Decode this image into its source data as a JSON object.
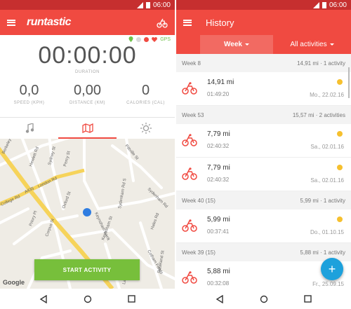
{
  "status_time": "06:00",
  "tracker": {
    "logo": "runtastic",
    "gps_label": "GPS",
    "duration_value": "00:00:00",
    "duration_label": "DURATION",
    "stats": [
      {
        "value": "0,0",
        "label": "SPEED (KPH)"
      },
      {
        "value": "0,00",
        "label": "DISTANCE (KM)"
      },
      {
        "value": "0",
        "label": "CALORIES (CAL)"
      }
    ],
    "tabs": [
      "music-icon",
      "map-icon",
      "weather-icon"
    ],
    "active_tab": 1,
    "map": {
      "streets": [
        "Berkeley St",
        "Hewlett Rd",
        "Sydney St",
        "Percy St",
        "Pittville St",
        "College Rd",
        "A435",
        "London Rd",
        "Oxford St",
        "Priory Pl",
        "Sydenham Rd",
        "Keynsham Bank",
        "Keynsham St",
        "Sydenham Rd S",
        "Hales Rd",
        "Cotham Fields",
        "Roseland St",
        "Corpus St",
        "Laxton Rd"
      ],
      "attribution": "Google"
    },
    "start_button": "START ACTIVITY"
  },
  "history": {
    "title": "History",
    "filter_week": "Week",
    "filter_all": "All activities",
    "groups": [
      {
        "week": "Week 8",
        "summary": "14,91 mi · 1 activity",
        "items": [
          {
            "distance": "14,91 mi",
            "duration": "01:49:20",
            "date": "Mo., 22.02.16"
          }
        ]
      },
      {
        "week": "Week 53",
        "summary": "15,57 mi · 2 activities",
        "items": [
          {
            "distance": "7,79 mi",
            "duration": "02:40:32",
            "date": "Sa., 02.01.16"
          },
          {
            "distance": "7,79 mi",
            "duration": "02:40:32",
            "date": "Sa., 02.01.16"
          }
        ]
      },
      {
        "week": "Week 40 (15)",
        "summary": "5,99 mi · 1 activity",
        "items": [
          {
            "distance": "5,99 mi",
            "duration": "00:37:41",
            "date": "Do., 01.10.15"
          }
        ]
      },
      {
        "week": "Week 39 (15)",
        "summary": "5,88 mi · 1 activity",
        "items": [
          {
            "distance": "5,88 mi",
            "duration": "00:32:08",
            "date": "Fr., 25.09.15"
          }
        ]
      }
    ],
    "fab_label": "+"
  },
  "colors": {
    "accent": "#f04a41",
    "start": "#77bf3b",
    "fab": "#1da1dc",
    "sun": "#f6c02e"
  }
}
